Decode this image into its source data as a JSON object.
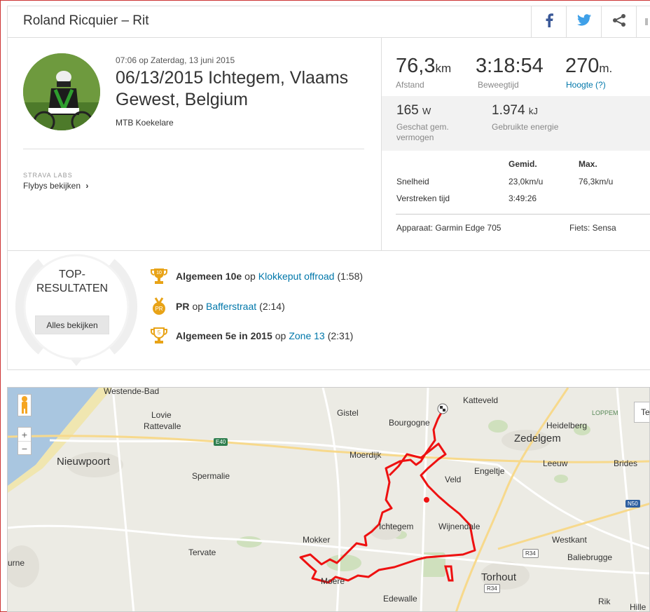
{
  "header": {
    "title": "Roland Ricquier – Rit",
    "share_icons": [
      "facebook-icon",
      "twitter-icon",
      "share-icon"
    ]
  },
  "activity": {
    "date": "07:06 op Zaterdag, 13 juni 2015",
    "title": "06/13/2015 Ichtegem, Vlaams Gewest, Belgium",
    "club": "MTB Koekelare",
    "labs_label": "STRAVA LABS",
    "flybys_label": "Flybys bekijken",
    "flybys_arrow": "›"
  },
  "stats": {
    "distance": {
      "value": "76,3",
      "unit": "km",
      "label": "Afstand"
    },
    "moving_time": {
      "value": "3:18:54",
      "label": "Beweegtijd"
    },
    "elevation": {
      "value": "270",
      "unit": "m.",
      "label": "Hoogte (?)"
    },
    "power": {
      "value": "165",
      "unit": "W",
      "label": "Geschat gem. vermogen"
    },
    "energy": {
      "value": "1.974",
      "unit": "kJ",
      "label": "Gebruikte energie"
    }
  },
  "table": {
    "headers": [
      "Gemid.",
      "Max."
    ],
    "rows": [
      {
        "label": "Snelheid",
        "avg": "23,0km/u",
        "max": "76,3km/u"
      },
      {
        "label": "Verstreken tijd",
        "avg": "3:49:26",
        "max": ""
      }
    ],
    "device": "Apparaat: Garmin Edge 705",
    "bike": "Fiets: Sensa"
  },
  "results": {
    "title": "TOP-RESULTATEN",
    "see_all": "Alles bekijken",
    "items": [
      {
        "badge": "10",
        "bold": "Algemeen 10e",
        "op": "op",
        "segment": "Klokkeput offroad",
        "time": "(1:58)",
        "badge_color": "#e8a317"
      },
      {
        "badge": "PR",
        "bold": "PR",
        "op": "op",
        "segment": "Bafferstraat",
        "time": "(2:14)",
        "badge_color": "#e8a317"
      },
      {
        "badge": "5",
        "bold": "Algemeen 5e in 2015",
        "op": "op",
        "segment": "Zone 13",
        "time": "(2:31)",
        "badge_color": "#e8a317"
      }
    ]
  },
  "map": {
    "zoom_in": "+",
    "zoom_out": "−",
    "corner_button": "Te",
    "route_color": "#ee1111",
    "places": [
      {
        "name": "Westende-Bad",
        "size": "normal"
      },
      {
        "name": "Lovie",
        "size": "normal"
      },
      {
        "name": "Rattevalle",
        "size": "normal"
      },
      {
        "name": "Gistel",
        "size": "normal"
      },
      {
        "name": "Katteveld",
        "size": "normal"
      },
      {
        "name": "Bourgogne",
        "size": "normal"
      },
      {
        "name": "LOPPEM",
        "size": "small"
      },
      {
        "name": "Heidelberg",
        "size": "normal"
      },
      {
        "name": "Zedelgem",
        "size": "big"
      },
      {
        "name": "Nieuwpoort",
        "size": "big"
      },
      {
        "name": "Moerdijk",
        "size": "normal"
      },
      {
        "name": "Engeltje",
        "size": "normal"
      },
      {
        "name": "Leeuw",
        "size": "normal"
      },
      {
        "name": "Brides",
        "size": "normal"
      },
      {
        "name": "Spermalie",
        "size": "normal"
      },
      {
        "name": "Veld",
        "size": "normal"
      },
      {
        "name": "Ichtegem",
        "size": "normal"
      },
      {
        "name": "Wijnendale",
        "size": "normal"
      },
      {
        "name": "Mokker",
        "size": "normal"
      },
      {
        "name": "Westkant",
        "size": "normal"
      },
      {
        "name": "Tervate",
        "size": "normal"
      },
      {
        "name": "Baliebrugge",
        "size": "normal"
      },
      {
        "name": "urne",
        "size": "normal"
      },
      {
        "name": "Torhout",
        "size": "big"
      },
      {
        "name": "Moere",
        "size": "normal"
      },
      {
        "name": "Edewalle",
        "size": "normal"
      },
      {
        "name": "Rik",
        "size": "normal"
      },
      {
        "name": "Hille",
        "size": "normal"
      }
    ],
    "roads": [
      "E40",
      "N50",
      "R34",
      "R34"
    ]
  }
}
